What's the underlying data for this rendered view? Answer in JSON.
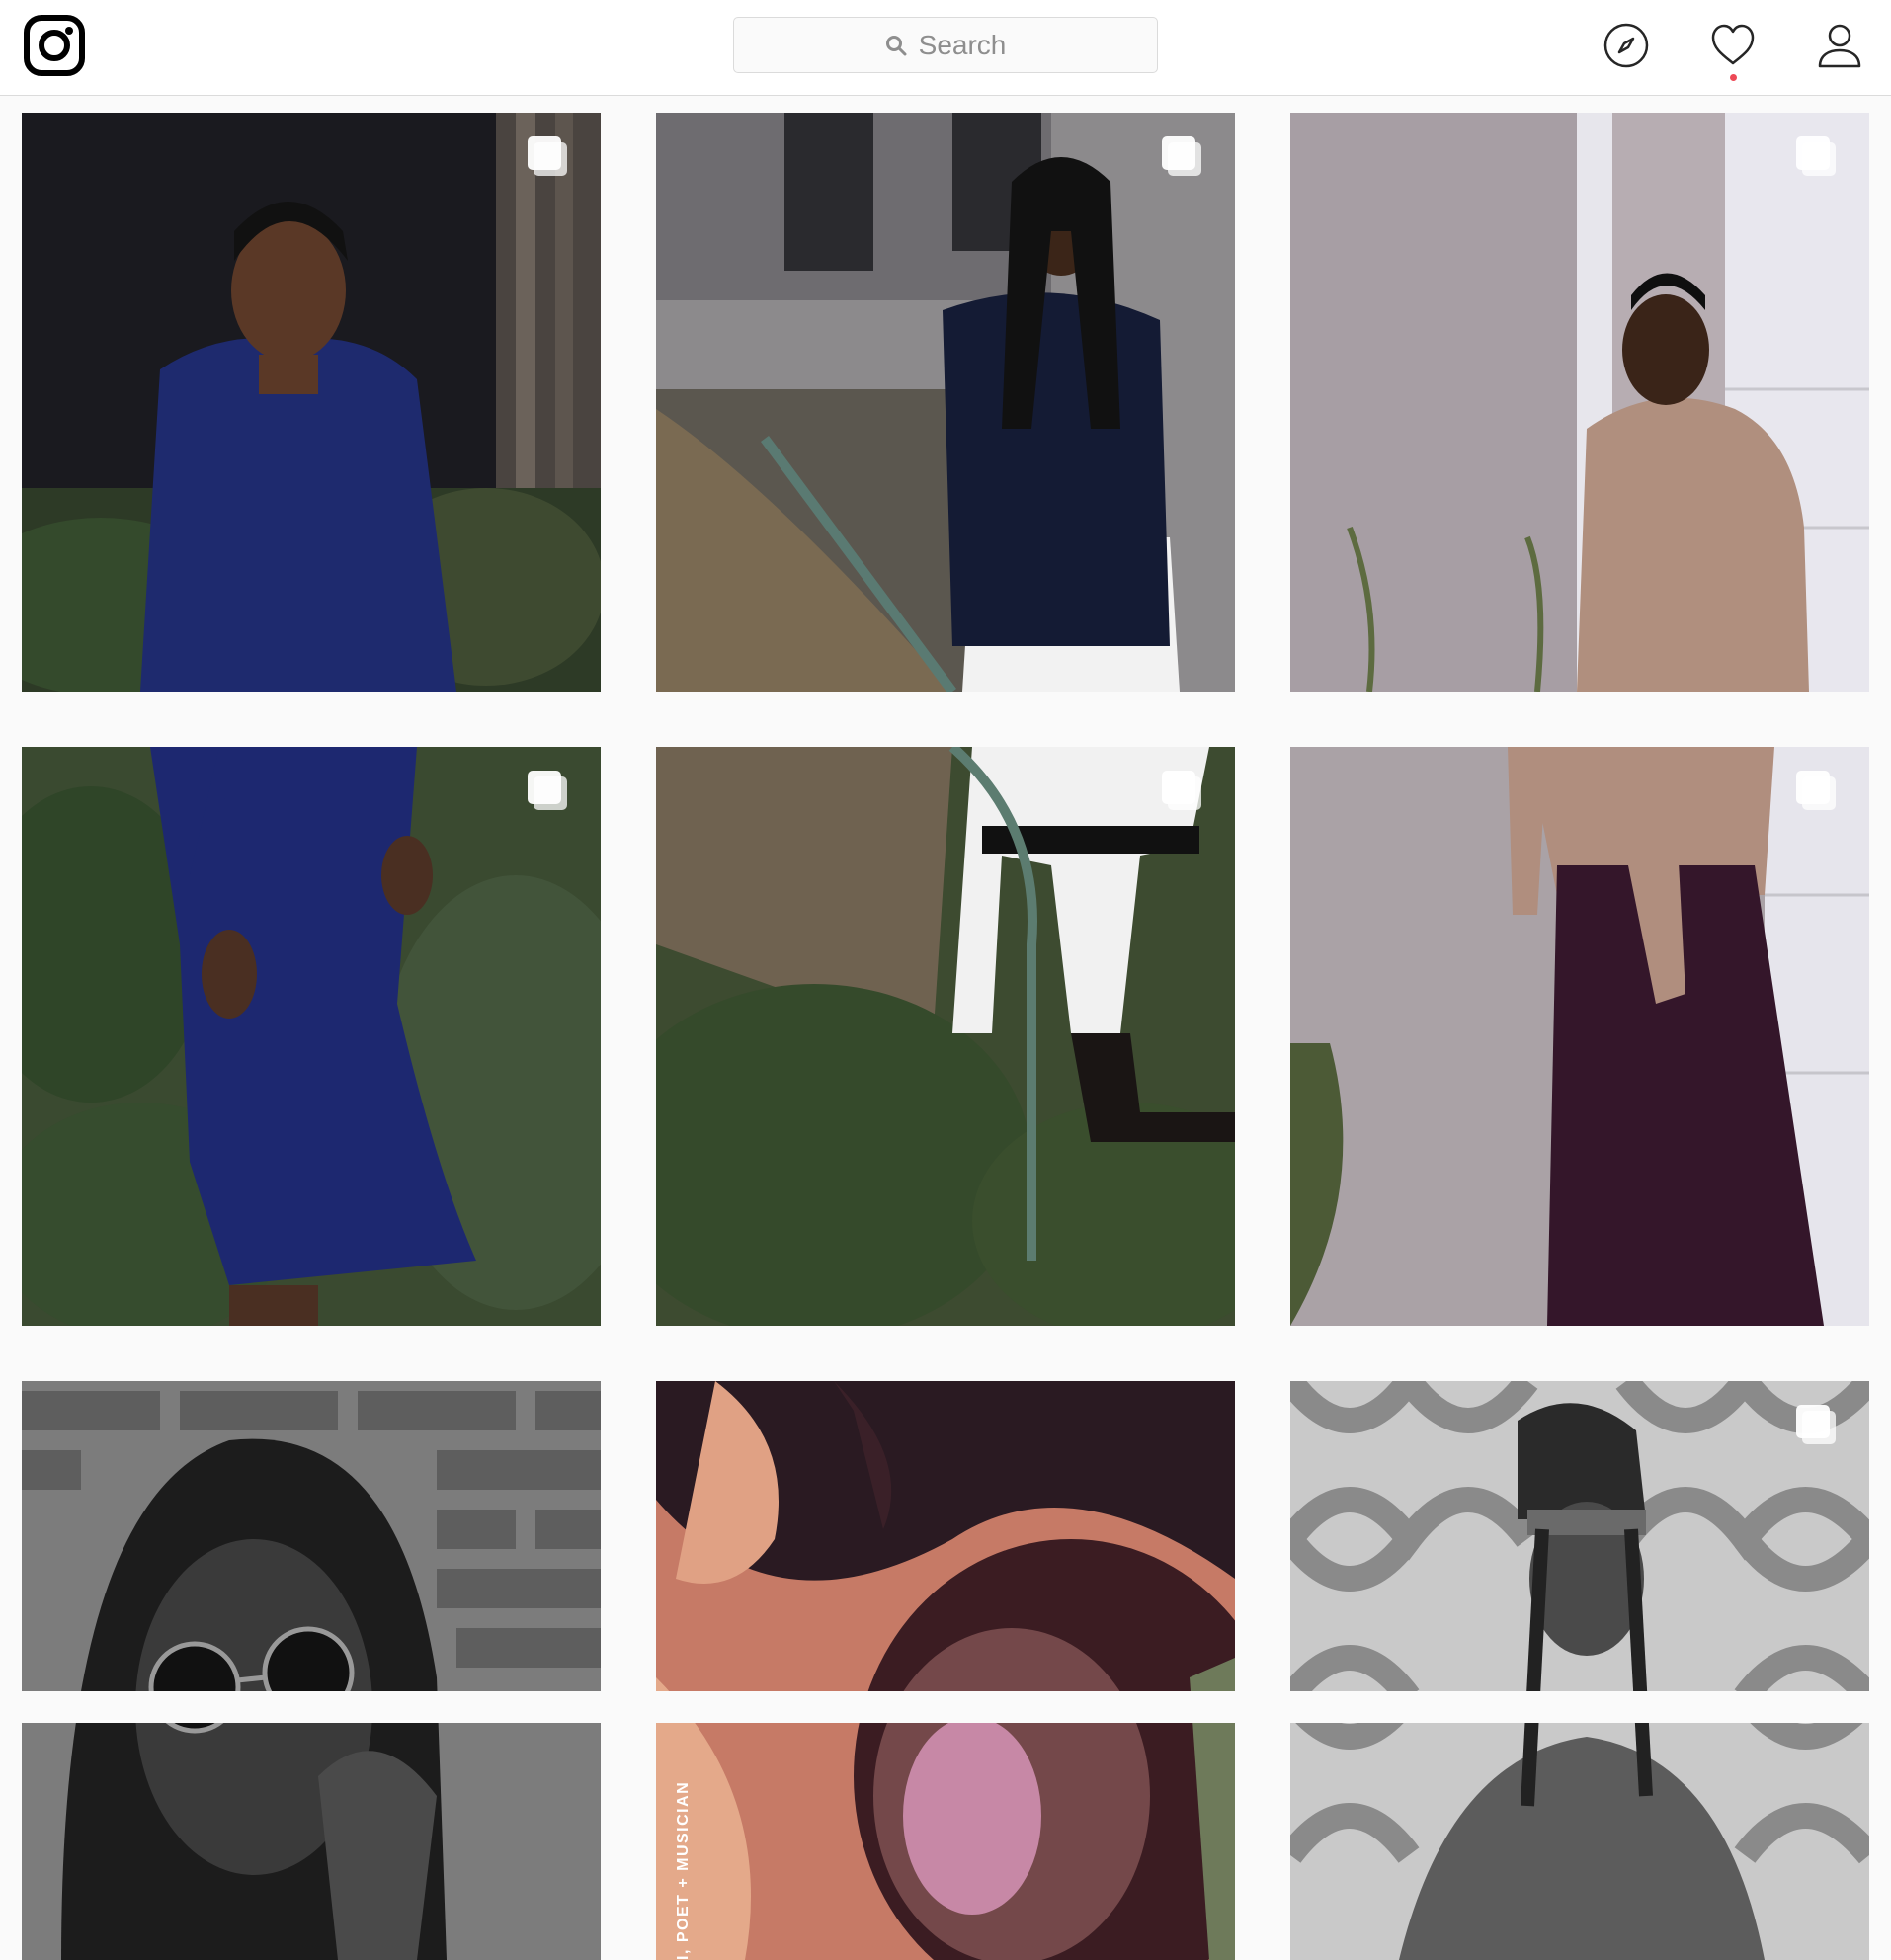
{
  "header": {
    "logo_icon": "instagram-logo-icon",
    "search": {
      "placeholder": "Search",
      "icon": "search-icon"
    },
    "nav": [
      {
        "name": "explore",
        "icon": "compass-icon"
      },
      {
        "name": "activity",
        "icon": "heart-icon",
        "has_notification": true,
        "notification_color": "#ed4956"
      },
      {
        "name": "profile",
        "icon": "user-icon"
      }
    ]
  },
  "grid": {
    "posts": [
      {
        "row": 1,
        "col": 1,
        "multiple": true
      },
      {
        "row": 1,
        "col": 2,
        "multiple": true
      },
      {
        "row": 1,
        "col": 3,
        "multiple": true
      },
      {
        "row": 2,
        "col": 1,
        "multiple": true
      },
      {
        "row": 2,
        "col": 2,
        "multiple": true
      },
      {
        "row": 2,
        "col": 3,
        "multiple": true
      },
      {
        "row": 3,
        "col": 1,
        "multiple": false
      },
      {
        "row": 3,
        "col": 2,
        "multiple": false,
        "caption": "I, POET + MUSICIAN"
      },
      {
        "row": 3,
        "col": 3,
        "multiple": true
      }
    ]
  }
}
